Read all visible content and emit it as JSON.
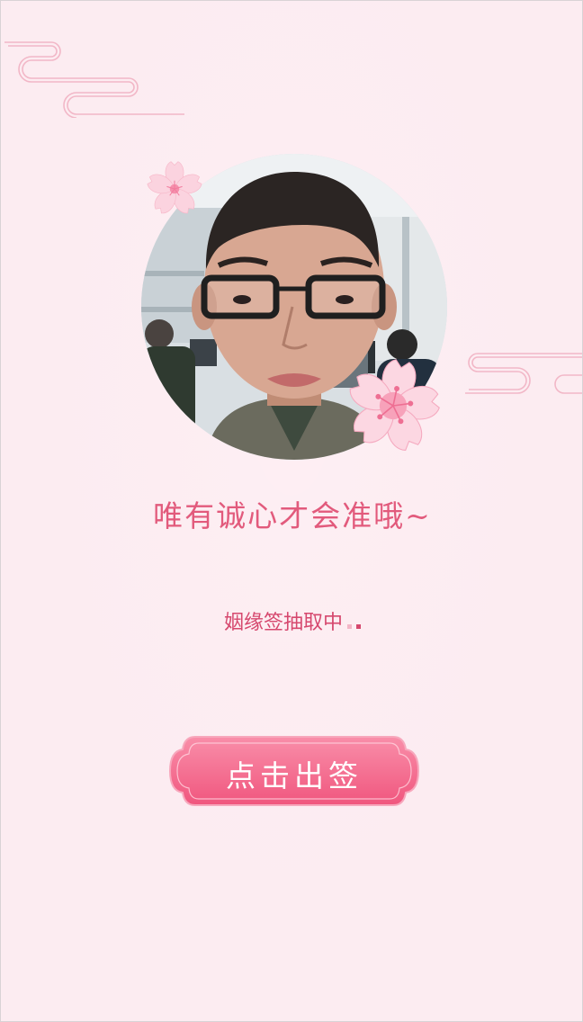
{
  "slogan": "唯有诚心才会准哦~",
  "status_text": "姻缘签抽取中",
  "draw_button_label": "点击出签",
  "colors": {
    "background": "#fcecf1",
    "accent": "#e25a7c",
    "status": "#d6486e",
    "button_top": "#f98ea9",
    "button_bottom": "#f0567e"
  },
  "icons": {
    "decor_top_left": "cloud-decor-icon",
    "decor_right": "cloud-decor-icon",
    "flower_small": "cherry-blossom-icon",
    "flower_large": "cherry-blossom-icon"
  }
}
